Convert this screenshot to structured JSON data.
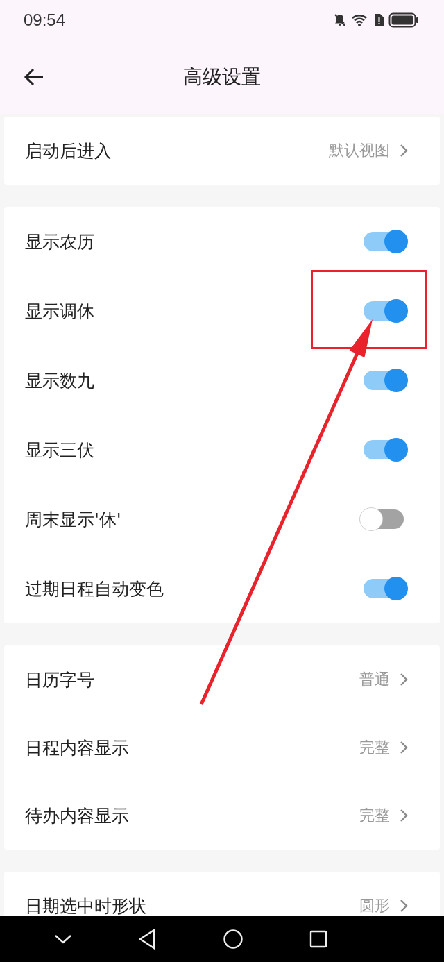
{
  "status_bar": {
    "time": "09:54"
  },
  "header": {
    "title": "高级设置"
  },
  "sections": [
    {
      "rows": [
        {
          "kind": "nav",
          "label": "启动后进入",
          "value": "默认视图"
        }
      ]
    },
    {
      "rows": [
        {
          "kind": "toggle",
          "label": "显示农历",
          "on": true
        },
        {
          "kind": "toggle",
          "label": "显示调休",
          "on": true
        },
        {
          "kind": "toggle",
          "label": "显示数九",
          "on": true
        },
        {
          "kind": "toggle",
          "label": "显示三伏",
          "on": true
        },
        {
          "kind": "toggle",
          "label": "周末显示'休'",
          "on": false
        },
        {
          "kind": "toggle",
          "label": "过期日程自动变色",
          "on": true
        }
      ]
    },
    {
      "rows": [
        {
          "kind": "nav",
          "label": "日历字号",
          "value": "普通"
        },
        {
          "kind": "nav",
          "label": "日程内容显示",
          "value": "完整"
        },
        {
          "kind": "nav",
          "label": "待办内容显示",
          "value": "完整"
        }
      ]
    },
    {
      "rows": [
        {
          "kind": "nav",
          "label": "日期选中时形状",
          "value": "圆形"
        }
      ]
    }
  ]
}
